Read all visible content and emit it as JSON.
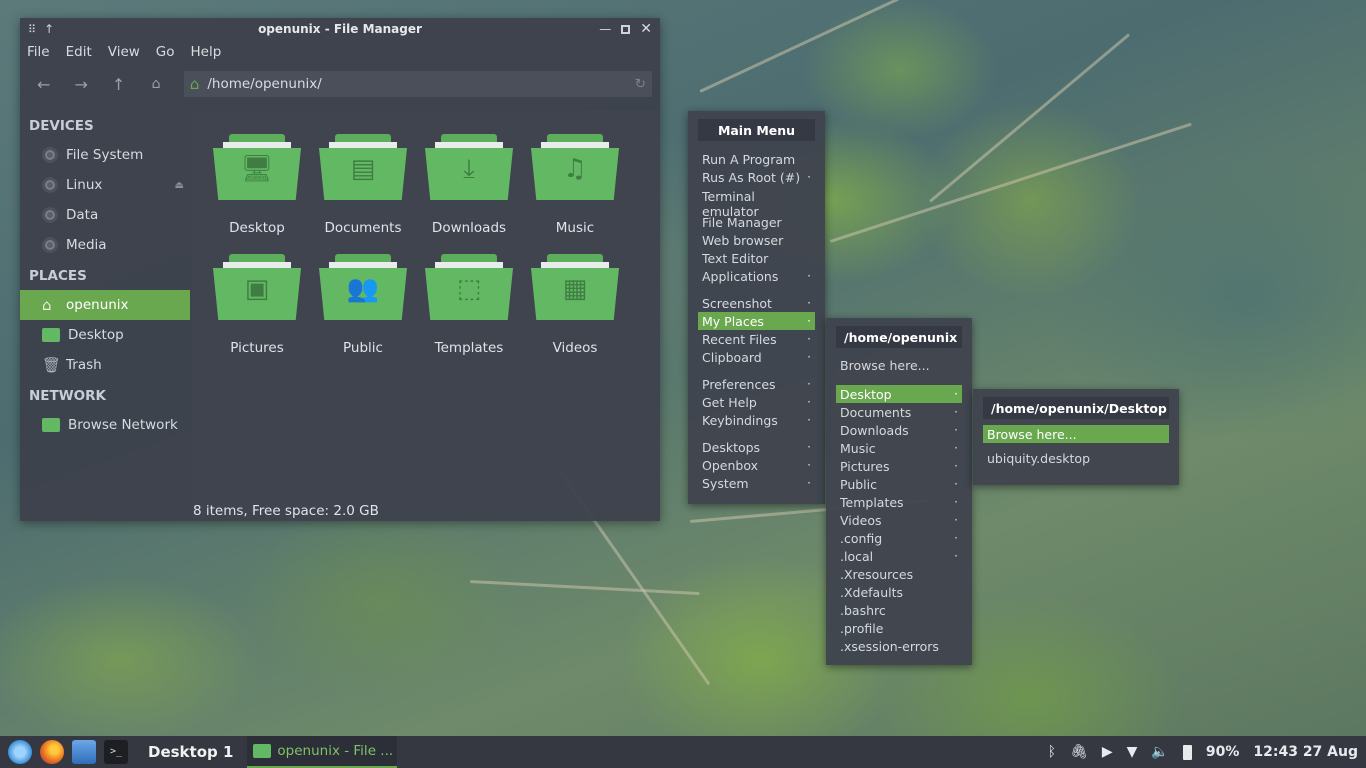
{
  "window": {
    "title": "openunix - File Manager",
    "menubar": [
      "File",
      "Edit",
      "View",
      "Go",
      "Help"
    ],
    "address": "/home/openunix/",
    "status": "8 items, Free space: 2.0 GB"
  },
  "sidebar": {
    "devices_heading": "DEVICES",
    "devices": [
      "File System",
      "Linux",
      "Data",
      "Media"
    ],
    "places_heading": "PLACES",
    "places": [
      "openunix",
      "Desktop",
      "Trash"
    ],
    "network_heading": "NETWORK",
    "network": [
      "Browse Network"
    ]
  },
  "files": [
    "Desktop",
    "Documents",
    "Downloads",
    "Music",
    "Pictures",
    "Public",
    "Templates",
    "Videos"
  ],
  "main_menu": {
    "title": "Main Menu",
    "items": [
      "Run A Program",
      "Rus As Root (#)",
      "Terminal emulator",
      "File Manager",
      "Web browser",
      "Text Editor",
      "Applications",
      "Screenshot",
      "My Places",
      "Recent Files",
      "Clipboard",
      "Preferences",
      "Get Help",
      "Keybindings",
      "Desktops",
      "Openbox",
      "System"
    ]
  },
  "places_menu": {
    "title": "/home/openunix",
    "browse": "Browse here...",
    "items": [
      "Desktop",
      "Documents",
      "Downloads",
      "Music",
      "Pictures",
      "Public",
      "Templates",
      "Videos",
      ".config",
      ".local",
      ".Xresources",
      ".Xdefaults",
      ".bashrc",
      ".profile",
      ".xsession-errors"
    ]
  },
  "desktop_menu": {
    "title": "/home/openunix/Desktop",
    "browse": "Browse here...",
    "items": [
      "ubiquity.desktop"
    ]
  },
  "taskbar": {
    "desktop": "Desktop 1",
    "task": "openunix - File ...",
    "battery": "90%",
    "clock": "12:43 27 Aug"
  },
  "colors": {
    "accent": "#6aa84f",
    "panel": "#3c404a"
  }
}
